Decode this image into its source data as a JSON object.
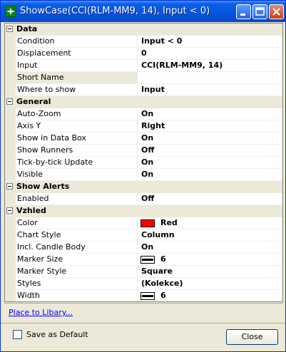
{
  "window": {
    "title": "ShowCase(CCI(RLM-MM9, 14), Input < 0)",
    "minimize_icon": "minimize-icon",
    "maximize_icon": "maximize-icon",
    "close_icon": "close-icon"
  },
  "property_grid": {
    "categories": [
      {
        "label": "Data",
        "properties": [
          {
            "name": "Condition",
            "value": "Input < 0"
          },
          {
            "name": "Displacement",
            "value": "0"
          },
          {
            "name": "Input",
            "value": "CCI(RLM-MM9, 14)"
          },
          {
            "name": "Short Name",
            "value": "",
            "selected": true
          },
          {
            "name": "Where to show",
            "value": "Input"
          }
        ]
      },
      {
        "label": "General",
        "properties": [
          {
            "name": "Auto-Zoom",
            "value": "On"
          },
          {
            "name": "Axis Y",
            "value": "Right"
          },
          {
            "name": "Show in Data Box",
            "value": "On"
          },
          {
            "name": "Show Runners",
            "value": "Off"
          },
          {
            "name": "Tick-by-tick Update",
            "value": "On"
          },
          {
            "name": "Visible",
            "value": "On"
          }
        ]
      },
      {
        "label": "Show Alerts",
        "properties": [
          {
            "name": "Enabled",
            "value": "Off"
          }
        ]
      },
      {
        "label": "Vzhled",
        "properties": [
          {
            "name": "Color",
            "value": "Red",
            "swatch_color": "#ff0000"
          },
          {
            "name": "Chart Style",
            "value": "Column"
          },
          {
            "name": "Incl. Candle Body",
            "value": "On"
          },
          {
            "name": "Marker Size",
            "value": "6",
            "line_swatch": true
          },
          {
            "name": "Marker Style",
            "value": "Square"
          },
          {
            "name": "Styles",
            "value": "(Kolekce)"
          },
          {
            "name": "Width",
            "value": "6",
            "line_swatch": true
          }
        ]
      }
    ]
  },
  "footer": {
    "link_label": "Place to Libary...",
    "checkbox_label": "Save as Default",
    "checkbox_checked": false,
    "close_label": "Close"
  },
  "colors": {
    "titlebar": "#0554e0",
    "dialog_bg": "#ece9d8",
    "accent_red": "#ff0000"
  }
}
